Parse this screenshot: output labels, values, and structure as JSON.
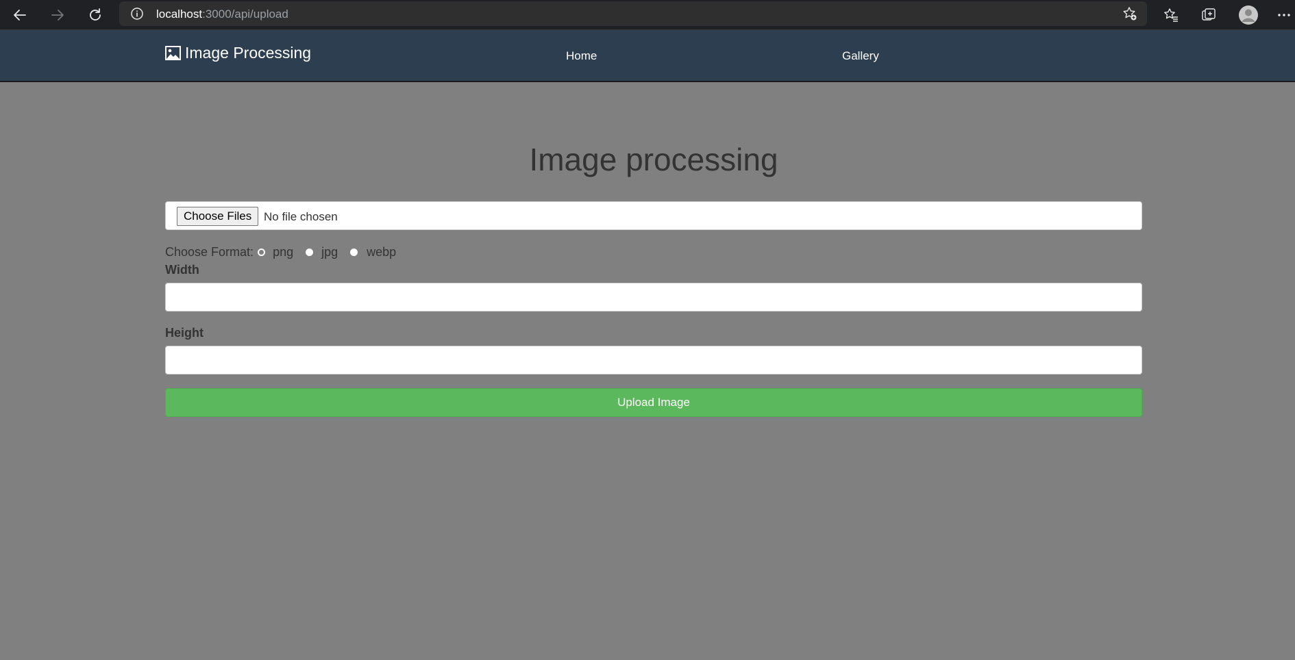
{
  "browser": {
    "url_host": "localhost",
    "url_path": ":3000/api/upload",
    "icons": [
      "back-arrow-icon",
      "forward-arrow-icon",
      "reload-icon",
      "info-icon",
      "add-favorite-icon",
      "favorites-icon",
      "collections-icon",
      "profile-icon",
      "more-icon"
    ]
  },
  "navbar": {
    "brand": "Image Processing",
    "links": [
      "Home",
      "Gallery"
    ],
    "background": "#2c3e50"
  },
  "main": {
    "title": "Image processing",
    "file_input": {
      "button_label": "Choose Files",
      "status": "No file chosen"
    },
    "format": {
      "label": "Choose Format:",
      "options": [
        "png",
        "jpg",
        "webp"
      ]
    },
    "width_label": "Width",
    "height_label": "Height",
    "submit_label": "Upload Image",
    "submit_color": "#5cb85c"
  }
}
